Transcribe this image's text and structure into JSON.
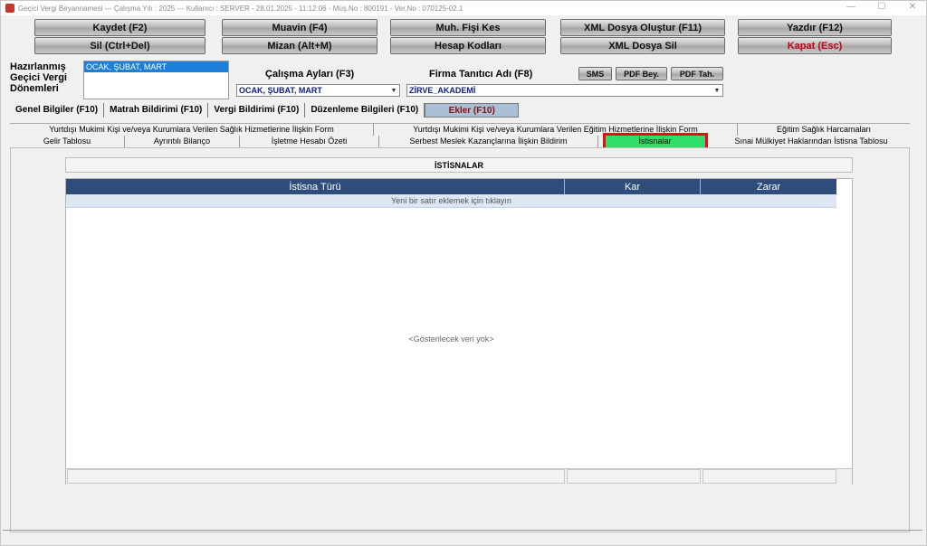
{
  "window": {
    "title": "Geçici Vergi Beyannamesi  ---  Çalışma Yılı : 2025  ---  Kullanıcı : SERVER - 28.01.2025 - 11:12:06 - Müş.No : 800191 - Ver.No : 070125-02.1",
    "min_glyph": "—",
    "max_glyph": "☐",
    "close_glyph": "✕"
  },
  "toolbar": {
    "row1": [
      "Kaydet (F2)",
      "Muavin (F4)",
      "Muh. Fişi Kes",
      "XML Dosya Oluştur (F11)",
      "Yazdır (F12)"
    ],
    "row2": [
      "Sil (Ctrl+Del)",
      "Mizan (Alt+M)",
      "Hesap Kodları",
      "XML Dosya Sil",
      "Kapat (Esc)"
    ]
  },
  "periods": {
    "label": "Hazırlanmış\nGeçici Vergi\nDönemleri",
    "items": [
      "OCAK, ŞUBAT, MART"
    ]
  },
  "work_months": {
    "label": "Çalışma Ayları (F3)",
    "value": "OCAK, ŞUBAT, MART"
  },
  "company": {
    "label": "Firma Tanıtıcı Adı (F8)",
    "value": "ZİRVE_AKADEMİ"
  },
  "small_buttons": [
    "SMS",
    "PDF Bey.",
    "PDF Tah."
  ],
  "main_tabs": [
    "Genel Bilgiler (F10)",
    "Matrah Bildirimi (F10)",
    "Vergi Bildirimi (F10)",
    "Düzenleme Bilgileri  (F10)",
    "Ekler (F10)"
  ],
  "sub_tabs_row1": [
    "Yurtdışı Mukimi Kişi ve/veya Kurumlara Verilen Sağlık Hizmetlerine İlişkin Form",
    "Yurtdışı Mukimi Kişi ve/veya Kurumlara Verilen Eğitim Hizmetlerine İlişkin Form",
    "Eğitim Sağlık Harcamaları"
  ],
  "sub_tabs_row2": [
    "Gelir Tablosu",
    "Ayrıntılı Bilanço",
    "İşletme Hesabı Özeti",
    "Serbest Meslek Kazançlarına İlişkin Bildirim",
    "İstisnalar",
    "Sınai Mülkiyet Haklarından İstisna Tablosu"
  ],
  "section_title": "İSTİSNALAR",
  "grid": {
    "columns": [
      "İstisna Türü",
      "Kar",
      "Zarar"
    ],
    "new_row_hint": "Yeni bir satır eklemek için tıklayın",
    "empty_text": "<Gösterilecek veri yok>"
  }
}
